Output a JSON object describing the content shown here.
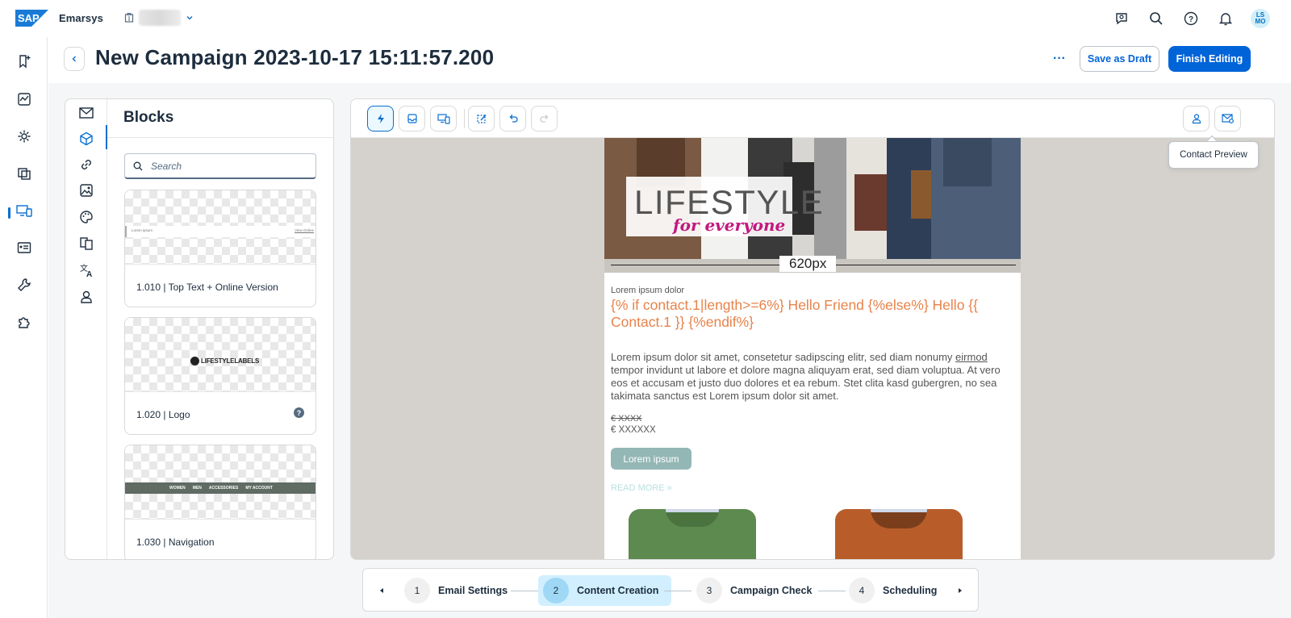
{
  "app": {
    "brand": "Emarsys"
  },
  "header": {
    "title": "New Campaign 2023-10-17 15:11:57.200",
    "more_label": "···",
    "save_draft_label": "Save as Draft",
    "finish_label": "Finish Editing"
  },
  "user": {
    "initials": "LS\nMO"
  },
  "blocks": {
    "title": "Blocks",
    "search_placeholder": "Search",
    "items": [
      {
        "label": "1.010 | Top Text + Online Version",
        "preview_left": "Lorem ipsum",
        "preview_right": "View Online"
      },
      {
        "label": "1.020 | Logo",
        "preview_text": "LIFESTYLELABELS"
      },
      {
        "label": "1.030 | Navigation",
        "nav_items": [
          "WOMEN",
          "MEN",
          "ACCESSORIES",
          "MY ACCOUNT"
        ]
      }
    ]
  },
  "email": {
    "hero_word": "LIFESTYLE",
    "hero_sub": "for everyone",
    "width_label": "620px",
    "intro": "Lorem ipsum dolor",
    "heading": "{% if contact.1|length>=6%} Hello Friend {%else%} Hello {{ Contact.1 }} {%endif%}",
    "body_pre": "Lorem ipsum dolor sit amet, consetetur sadipscing elitr, sed diam nonumy ",
    "body_underlined": "eirmod",
    "body_post": " tempor invidunt ut labore et dolore magna aliquyam erat, sed diam voluptua. At vero eos et accusam et justo duo dolores et ea rebum. Stet clita kasd gubergren, no sea takimata sanctus est Lorem ipsum dolor sit amet.",
    "old_price": "€ XXXX",
    "price": "€ XXXXXX",
    "cta": "Lorem ipsum",
    "read_more": "READ MORE »"
  },
  "tooltip": {
    "contact_preview": "Contact Preview"
  },
  "steps": [
    {
      "num": "1",
      "label": "Email Settings"
    },
    {
      "num": "2",
      "label": "Content Creation"
    },
    {
      "num": "3",
      "label": "Campaign Check"
    },
    {
      "num": "4",
      "label": "Scheduling"
    }
  ],
  "colors": {
    "accent": "#0064d9",
    "heading_orange": "#e8834a",
    "cta_teal": "#93b7b5",
    "canvas_bg": "#d5d2cd"
  }
}
